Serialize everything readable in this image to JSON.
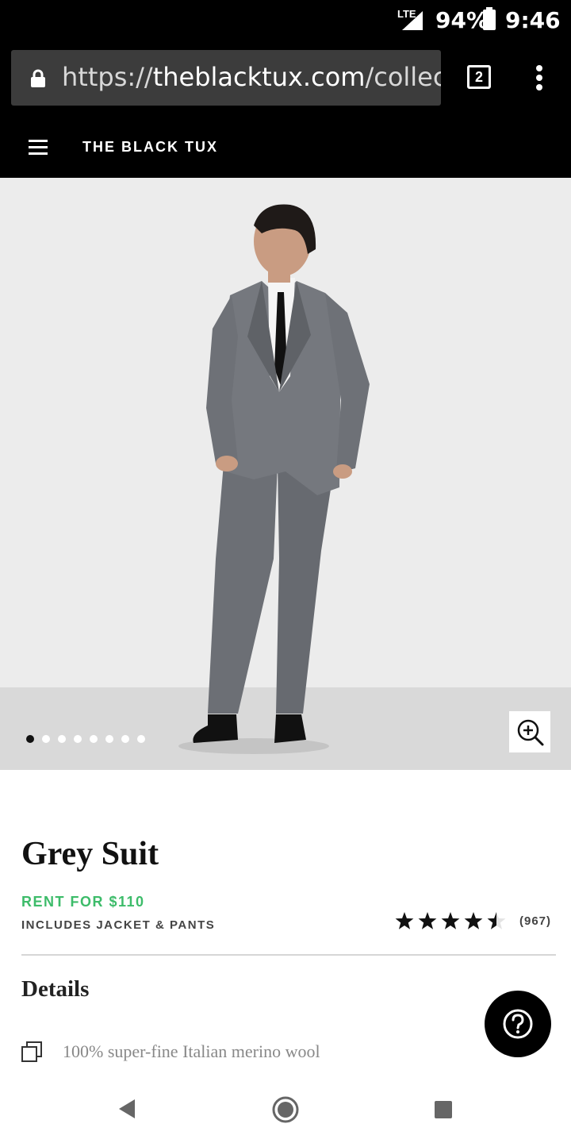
{
  "status_bar": {
    "network": "LTE",
    "battery_percent": "94%",
    "time": "9:46"
  },
  "browser": {
    "url_scheme": "https://",
    "url_host": "theblacktux.com",
    "url_path": "/collectio",
    "tab_count": "2"
  },
  "site": {
    "brand": "THE BLACK TUX"
  },
  "gallery": {
    "image_count": 8,
    "active_index": 0
  },
  "product": {
    "title": "Grey Suit",
    "price_label": "RENT FOR $110",
    "includes_label": "INCLUDES JACKET & PANTS",
    "rating": 4.5,
    "review_count": "(967)"
  },
  "details": {
    "heading": "Details",
    "items": [
      {
        "icon": "layers-icon",
        "text": "100% super-fine Italian merino wool"
      }
    ]
  },
  "colors": {
    "brand_black": "#000000",
    "price_green": "#3dbc6a",
    "suit_grey": "#707379"
  }
}
